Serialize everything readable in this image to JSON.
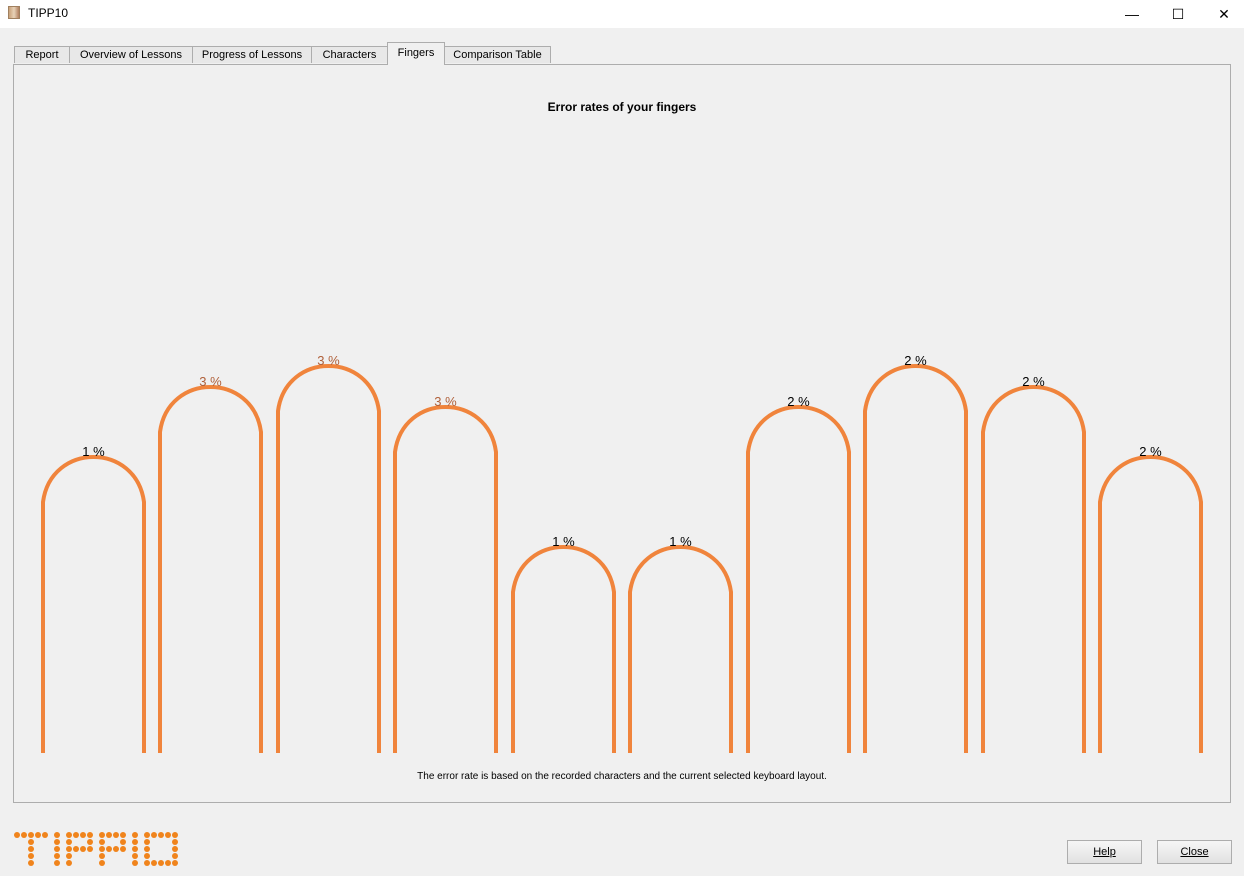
{
  "window": {
    "title": "TIPP10",
    "controls": [
      "minimize-icon",
      "maximize-icon",
      "close-icon"
    ]
  },
  "tabs": [
    {
      "label": "Report"
    },
    {
      "label": "Overview of Lessons"
    },
    {
      "label": "Progress of Lessons"
    },
    {
      "label": "Characters"
    },
    {
      "label": "Fingers",
      "active": true
    },
    {
      "label": "Comparison Table"
    }
  ],
  "fingers_view": {
    "title": "Error rates of your fingers",
    "footnote": "The error rate is based on the recorded characters and the current selected keyboard layout.",
    "finger_color": "#f0843c",
    "fingers": [
      {
        "label": "1 %",
        "value": 1,
        "label_color": "#000000"
      },
      {
        "label": "3 %",
        "value": 3,
        "label_color": "#b0603a"
      },
      {
        "label": "3 %",
        "value": 3,
        "label_color": "#b0603a"
      },
      {
        "label": "3 %",
        "value": 3,
        "label_color": "#b0603a"
      },
      {
        "label": "1 %",
        "value": 1,
        "label_color": "#000000"
      },
      {
        "label": "1 %",
        "value": 1,
        "label_color": "#000000"
      },
      {
        "label": "2 %",
        "value": 2,
        "label_color": "#000000"
      },
      {
        "label": "2 %",
        "value": 2,
        "label_color": "#000000"
      },
      {
        "label": "2 %",
        "value": 2,
        "label_color": "#000000"
      },
      {
        "label": "2 %",
        "value": 2,
        "label_color": "#000000"
      }
    ]
  },
  "logo": {
    "text": "TIPP10",
    "color": "#f0841c"
  },
  "buttons": {
    "help": "Help",
    "close": "Close"
  }
}
